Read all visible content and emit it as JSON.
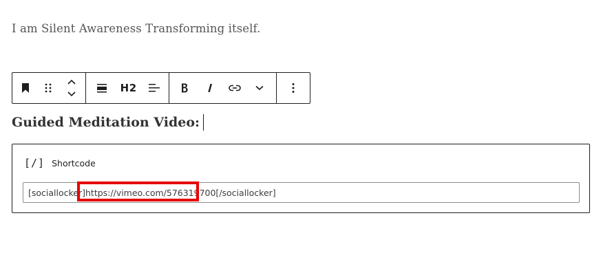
{
  "editor": {
    "paragraph_text": "I am Silent Awareness Transforming itself.",
    "heading_text": "Guided Meditation Video:"
  },
  "toolbar": {
    "groups": [
      {
        "items": [
          {
            "icon": "bookmark-icon",
            "label": "Bookmark"
          },
          {
            "icon": "drag-handle-icon",
            "label": "Drag"
          },
          {
            "icon": "move-up-down-icon",
            "label": "Move up/down"
          }
        ]
      },
      {
        "items": [
          {
            "icon": "align-icon",
            "label": "Align"
          },
          {
            "icon": "heading-level-icon",
            "label": "H2"
          },
          {
            "icon": "text-align-icon",
            "label": "Align text"
          }
        ]
      },
      {
        "items": [
          {
            "icon": "bold-icon",
            "label": "B"
          },
          {
            "icon": "italic-icon",
            "label": "I"
          },
          {
            "icon": "link-icon",
            "label": "Link"
          },
          {
            "icon": "chevron-down-icon",
            "label": "More"
          }
        ]
      },
      {
        "items": [
          {
            "icon": "more-options-icon",
            "label": "Options"
          }
        ]
      }
    ],
    "heading_level_label": "H2",
    "bold_label": "B",
    "italic_label": "I"
  },
  "shortcode_block": {
    "icon_text": "[/]",
    "label": "Shortcode",
    "input_value": "[sociallocker]https://vimeo.com/576319700[/sociallocker]"
  },
  "annotation": {
    "highlight_color": "#e60000"
  }
}
